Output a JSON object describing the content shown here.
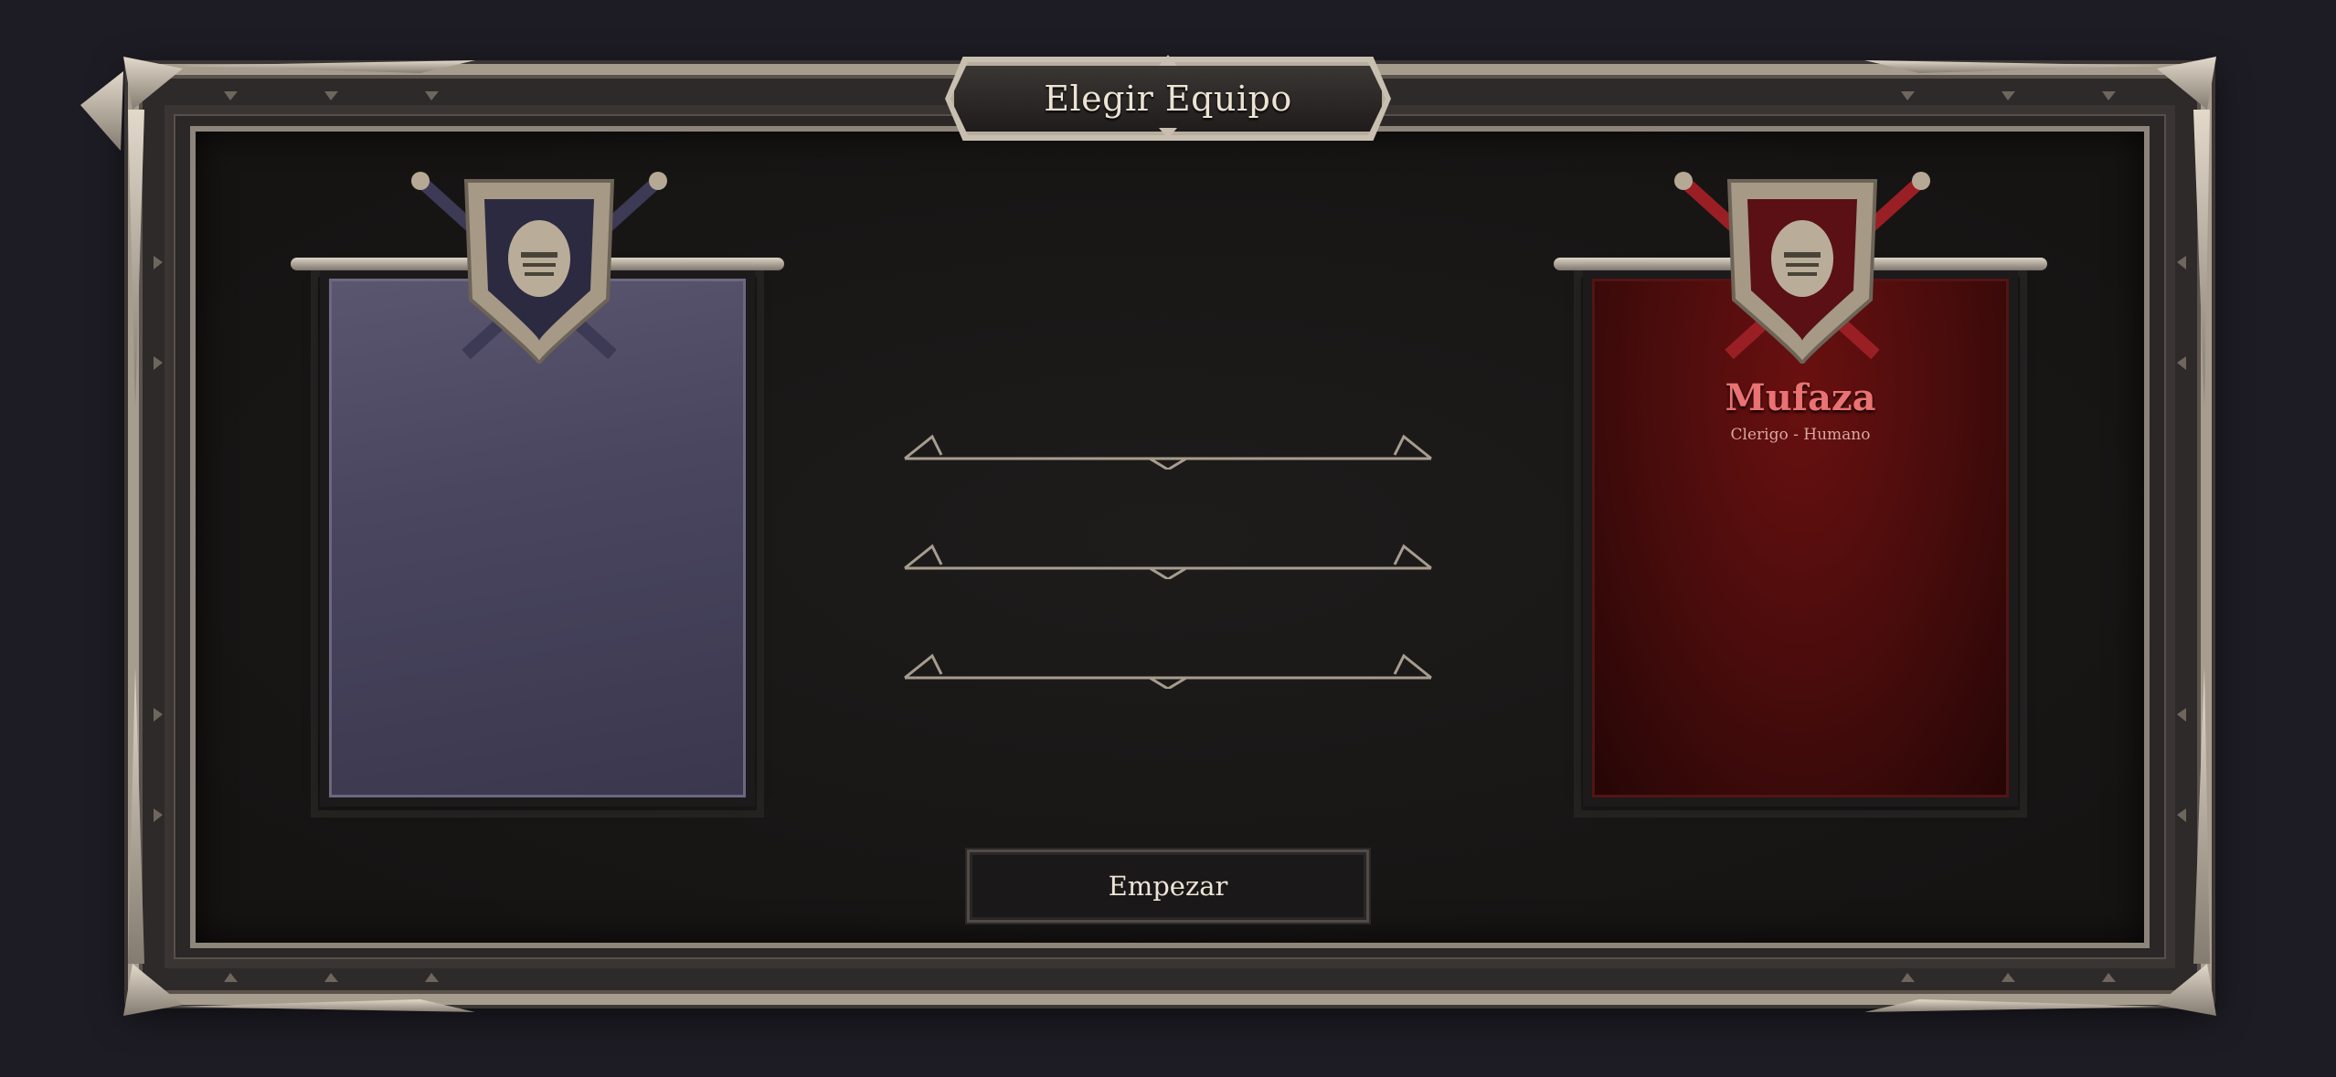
{
  "title": "Elegir Equipo",
  "teams": [
    {
      "color": "blue",
      "banner_color": "#4a4660",
      "player_name": "",
      "player_subtitle": ""
    },
    {
      "color": "red",
      "banner_color": "#4a0c0c",
      "player_name": "Mufaza",
      "player_subtitle": "Clerigo - Humano"
    }
  ],
  "start_button_label": "Empezar",
  "colors": {
    "background": "#1d1c24",
    "frame_metal": "#a79d8f",
    "player_name": "#ea7272"
  }
}
